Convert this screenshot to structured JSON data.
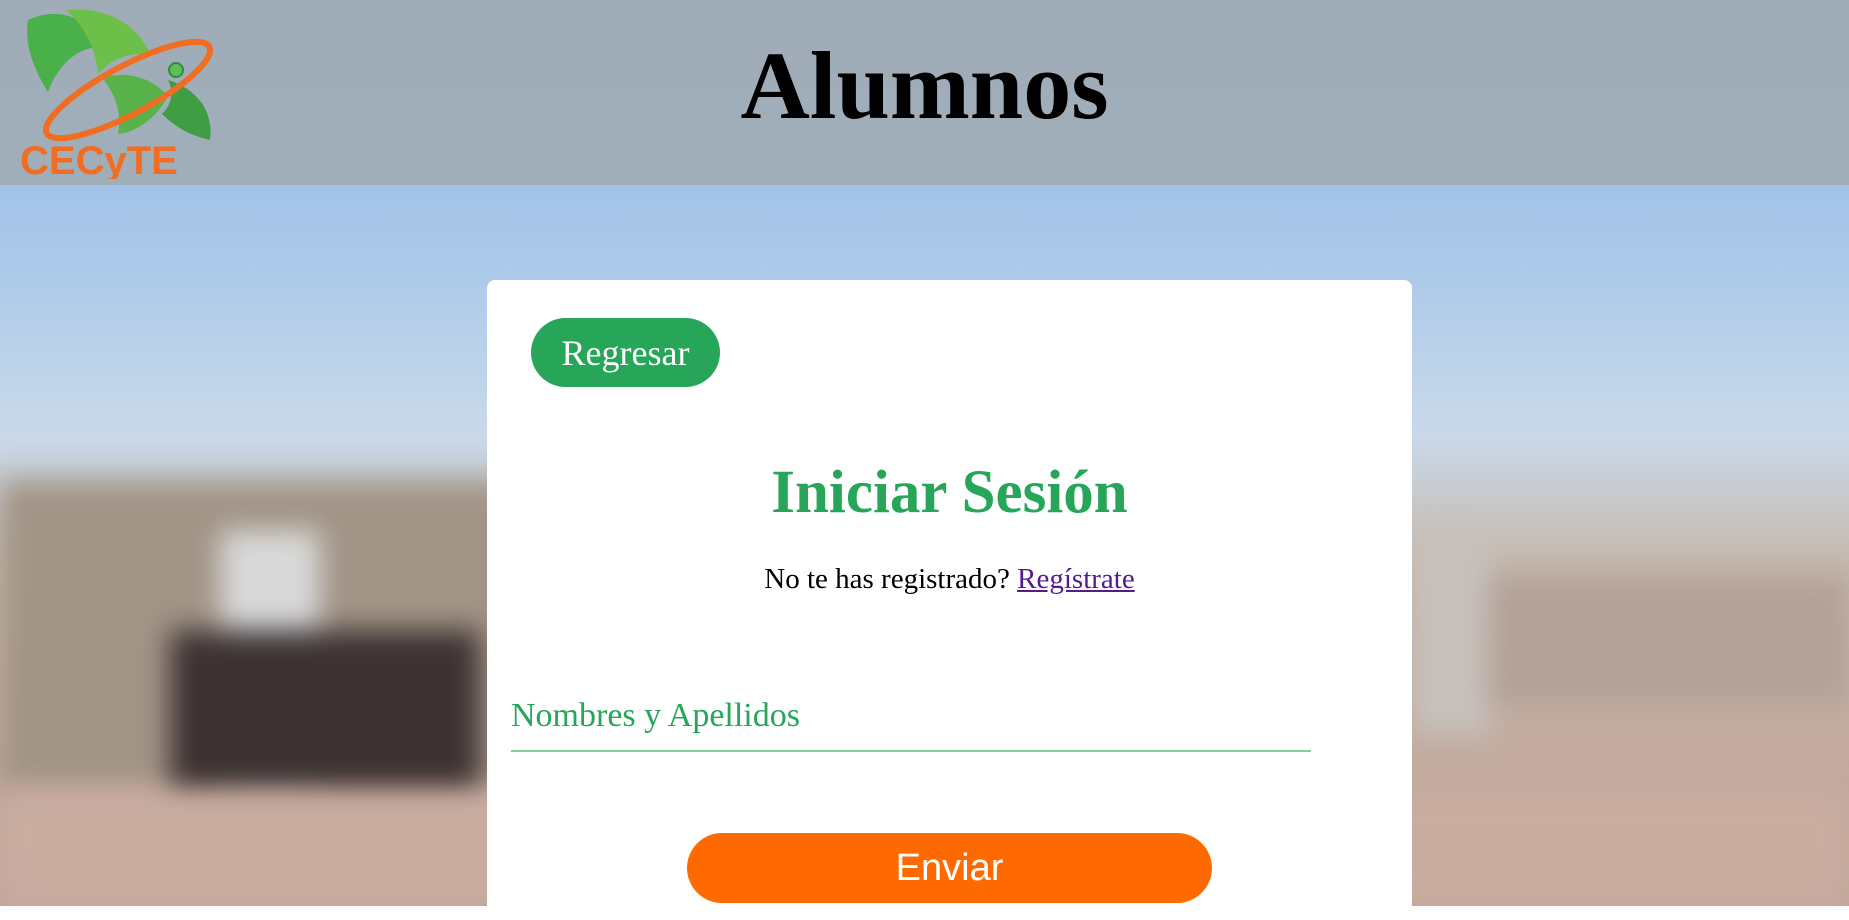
{
  "header": {
    "title": "Alumnos",
    "logo_text": "CECyTE"
  },
  "card": {
    "back_label": "Regresar",
    "form_title": "Iniciar Sesión",
    "register_prompt": "No te has registrado?",
    "register_link": "Regístrate",
    "name_placeholder": "Nombres y Apellidos",
    "name_value": "",
    "submit_label": "Enviar"
  },
  "colors": {
    "accent_green": "#27a65a",
    "accent_orange": "#ff6a00",
    "header_gray": "#a0adb7"
  }
}
